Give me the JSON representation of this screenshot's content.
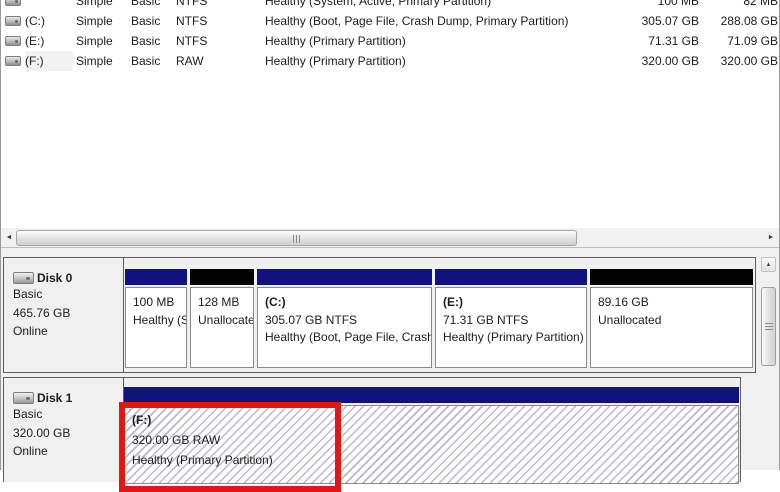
{
  "colors": {
    "partition_header_volume": "#12127c",
    "partition_header_unallocated": "#020202",
    "annotation_red": "#e31616",
    "pane_background": "#f0f0f0",
    "selection_hatch_line": "#b9b9c4"
  },
  "icons": {
    "scroll_left": "◄",
    "scroll_right": "►",
    "scroll_up": "▲",
    "volume_icon": "drive-glyph",
    "disk_icon": "drive-glyph"
  },
  "volume_list": {
    "rows": [
      {
        "volume": "",
        "layout": "Simple",
        "type": "Basic",
        "fs": "NTFS",
        "status": "Healthy (System, Active, Primary Partition)",
        "capacity": "100 MB",
        "free_space": "82 MB"
      },
      {
        "volume": "(C:)",
        "layout": "Simple",
        "type": "Basic",
        "fs": "NTFS",
        "status": "Healthy (Boot, Page File, Crash Dump, Primary Partition)",
        "capacity": "305.07 GB",
        "free_space": "288.08 GB"
      },
      {
        "volume": "(E:)",
        "layout": "Simple",
        "type": "Basic",
        "fs": "NTFS",
        "status": "Healthy (Primary Partition)",
        "capacity": "71.31 GB",
        "free_space": "71.09 GB"
      },
      {
        "volume": "(F:)",
        "layout": "Simple",
        "type": "Basic",
        "fs": "RAW",
        "status": "Healthy (Primary Partition)",
        "capacity": "320.00 GB",
        "free_space": "320.00 GB"
      }
    ]
  },
  "disks": [
    {
      "name": "Disk 0",
      "kind": "Basic",
      "size": "465.76 GB",
      "status": "Online",
      "partitions": [
        {
          "name": "",
          "line2": "100 MB",
          "line3": "Healthy (System, Active, Primary Partition)"
        },
        {
          "name": "",
          "line2": "128 MB",
          "line3": "Unallocated"
        },
        {
          "name": "(C:)",
          "line2": "305.07 GB NTFS",
          "line3": "Healthy (Boot, Page File, Crash Dump, Primary Partition)"
        },
        {
          "name": "(E:)",
          "line2": "71.31 GB NTFS",
          "line3": "Healthy (Primary Partition)"
        },
        {
          "name": "",
          "line2": "89.16 GB",
          "line3": "Unallocated"
        }
      ]
    },
    {
      "name": "Disk 1",
      "kind": "Basic",
      "size": "320.00 GB",
      "status": "Online",
      "partitions": [
        {
          "name": "(F:)",
          "line2": "320.00 GB RAW",
          "line3": "Healthy (Primary Partition)"
        }
      ]
    }
  ]
}
